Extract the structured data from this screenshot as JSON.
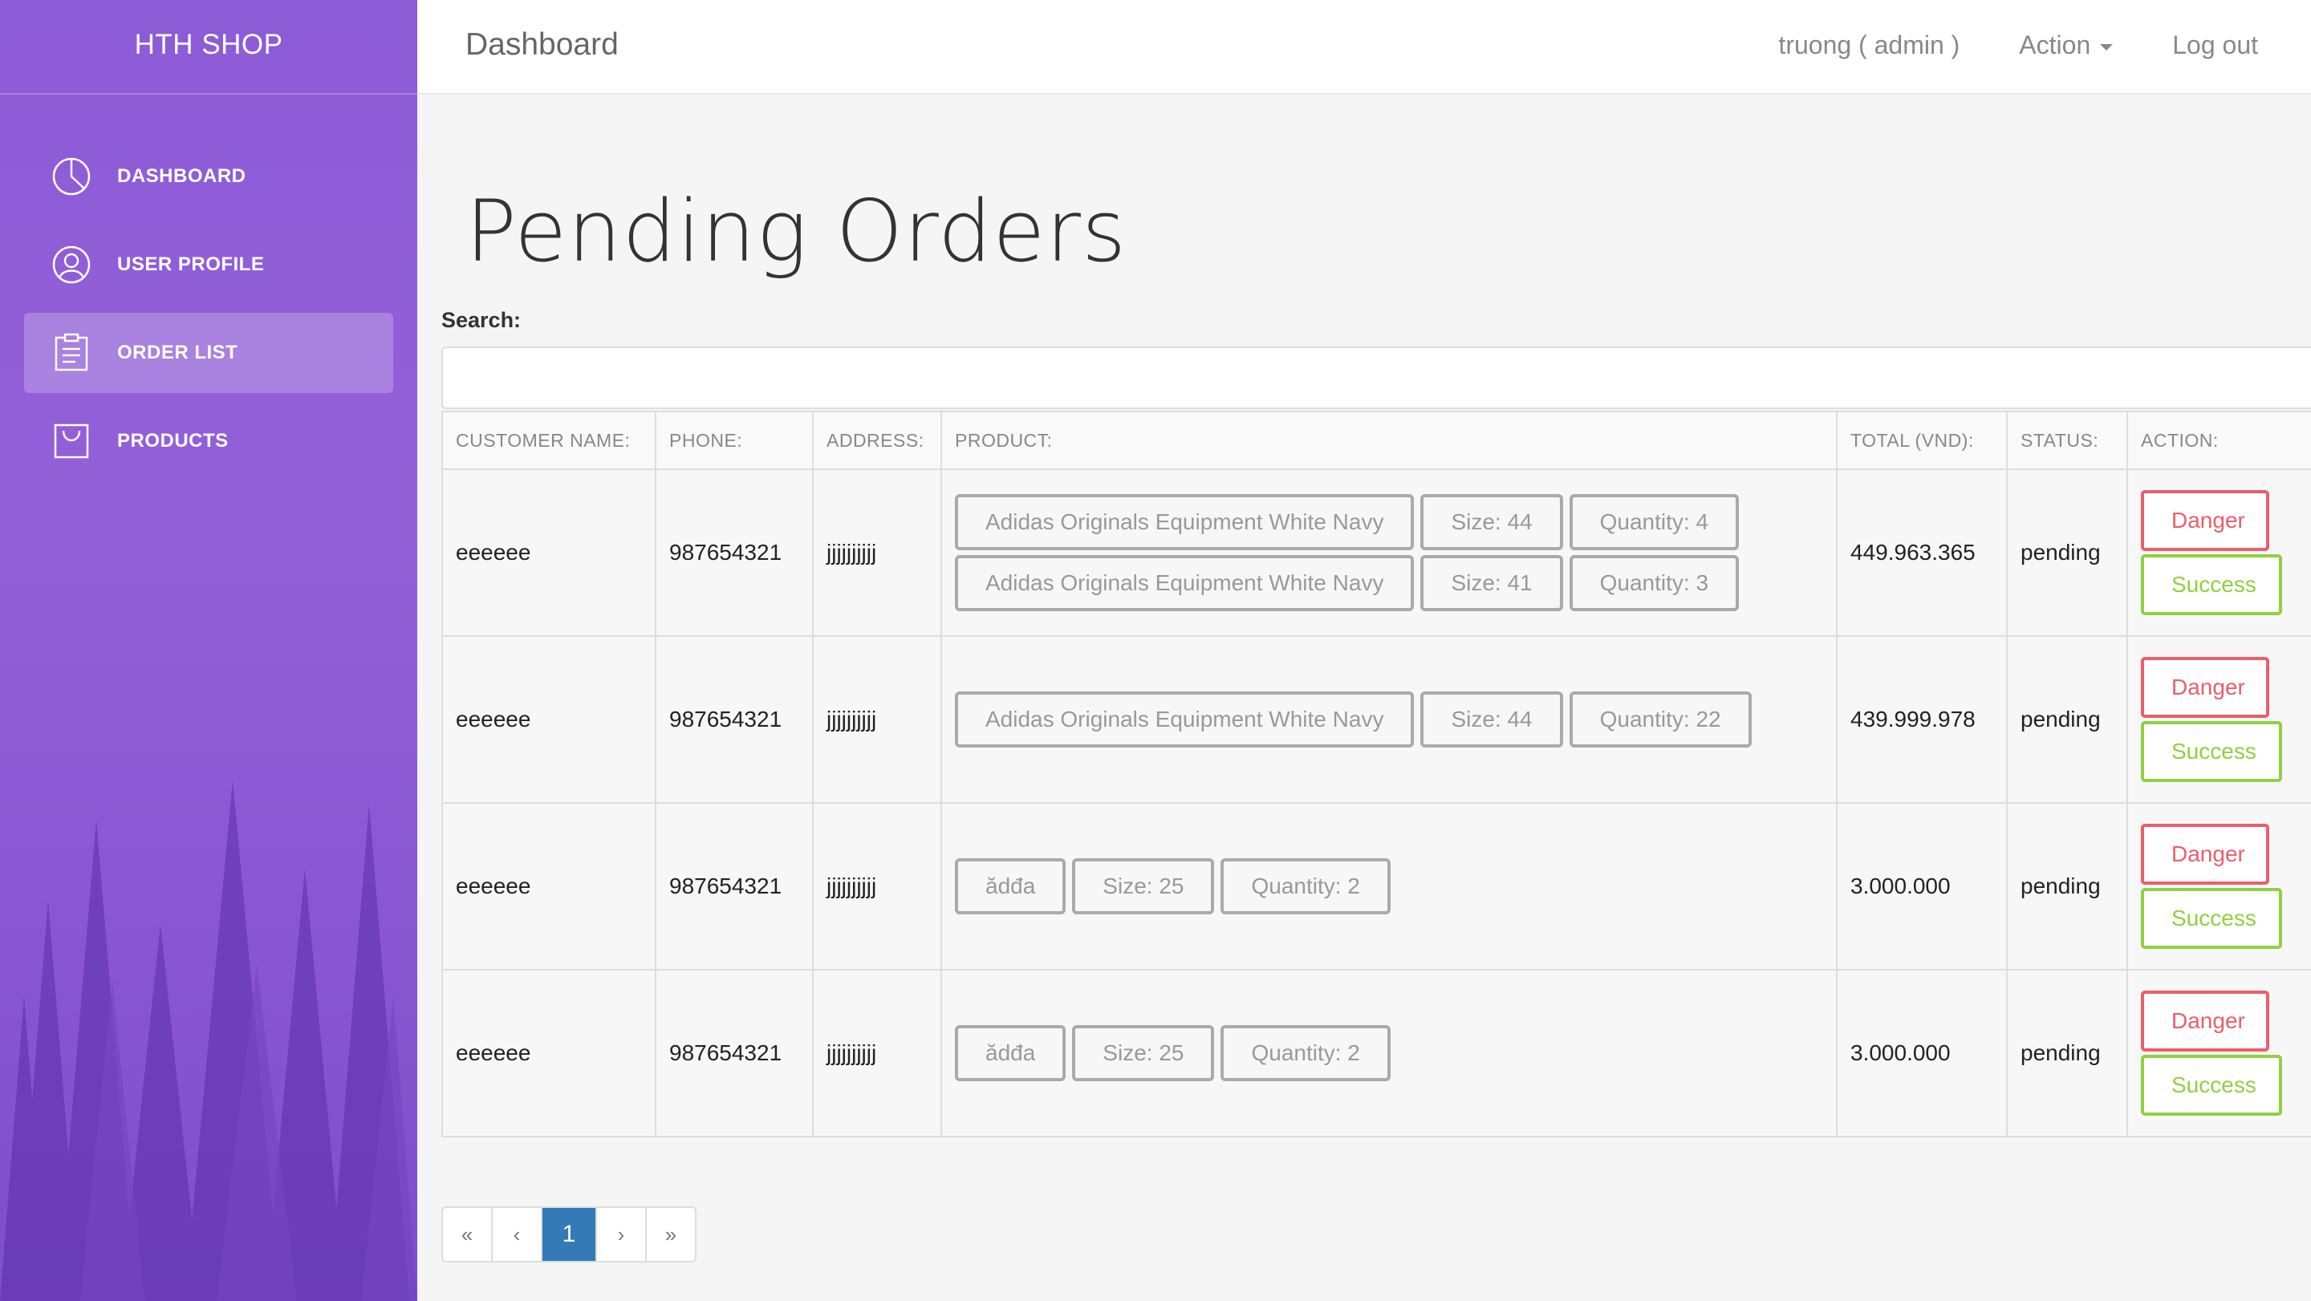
{
  "brand": "HTH SHOP",
  "sidebar": {
    "items": [
      {
        "label": "DASHBOARD",
        "icon": "pie-chart-icon"
      },
      {
        "label": "USER PROFILE",
        "icon": "user-icon"
      },
      {
        "label": "ORDER LIST",
        "icon": "clipboard-icon"
      },
      {
        "label": "PRODUCTS",
        "icon": "bag-icon"
      }
    ],
    "active": "ORDER LIST"
  },
  "topbar": {
    "title": "Dashboard",
    "user": "truong ( admin )",
    "action": "Action",
    "logout": "Log out"
  },
  "page": {
    "title": "Pending Orders",
    "search_label": "Search:",
    "search_value": ""
  },
  "table": {
    "headers": [
      "CUSTOMER NAME:",
      "PHONE:",
      "ADDRESS:",
      "PRODUCT:",
      "TOTAL (VND):",
      "STATUS:",
      "ACTION:"
    ],
    "rows": [
      {
        "customer": "eeeeee",
        "phone": "987654321",
        "address": "jjjjjjjjjj",
        "products": [
          {
            "name": "Adidas Originals Equipment White Navy",
            "size": "Size: 44",
            "qty": "Quantity: 4"
          },
          {
            "name": "Adidas Originals Equipment White Navy",
            "size": "Size: 41",
            "qty": "Quantity: 3"
          }
        ],
        "total": "449.963.365",
        "status": "pending",
        "danger": "Danger",
        "success": "Success"
      },
      {
        "customer": "eeeeee",
        "phone": "987654321",
        "address": "jjjjjjjjjj",
        "products": [
          {
            "name": "Adidas Originals Equipment White Navy",
            "size": "Size: 44",
            "qty": "Quantity: 22"
          }
        ],
        "total": "439.999.978",
        "status": "pending",
        "danger": "Danger",
        "success": "Success"
      },
      {
        "customer": "eeeeee",
        "phone": "987654321",
        "address": "jjjjjjjjjj",
        "products": [
          {
            "name": "ădđa",
            "size": "Size: 25",
            "qty": "Quantity: 2"
          }
        ],
        "total": "3.000.000",
        "status": "pending",
        "danger": "Danger",
        "success": "Success"
      },
      {
        "customer": "eeeeee",
        "phone": "987654321",
        "address": "jjjjjjjjjj",
        "products": [
          {
            "name": "ădđa",
            "size": "Size: 25",
            "qty": "Quantity: 2"
          }
        ],
        "total": "3.000.000",
        "status": "pending",
        "danger": "Danger",
        "success": "Success"
      }
    ]
  },
  "pagination": {
    "first": "«",
    "prev": "‹",
    "current": "1",
    "next": "›",
    "last": "»"
  },
  "colors": {
    "sidebar": "#8c5bd6",
    "danger": "#eb5e6a",
    "success": "#8fd13f",
    "page_active": "#337ab7"
  }
}
